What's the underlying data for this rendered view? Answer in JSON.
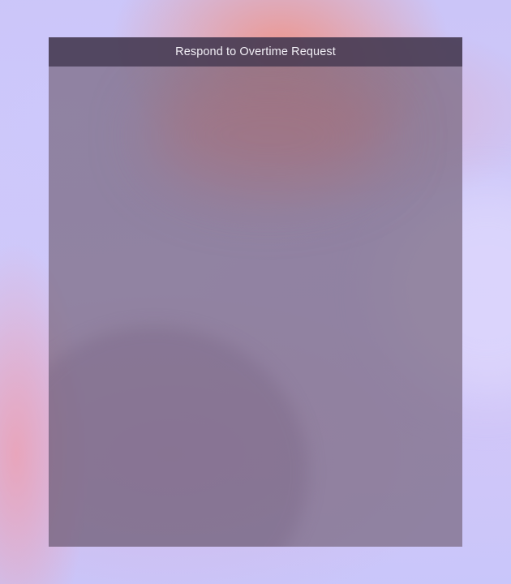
{
  "dialog": {
    "title": "Respond to Overtime Request"
  }
}
